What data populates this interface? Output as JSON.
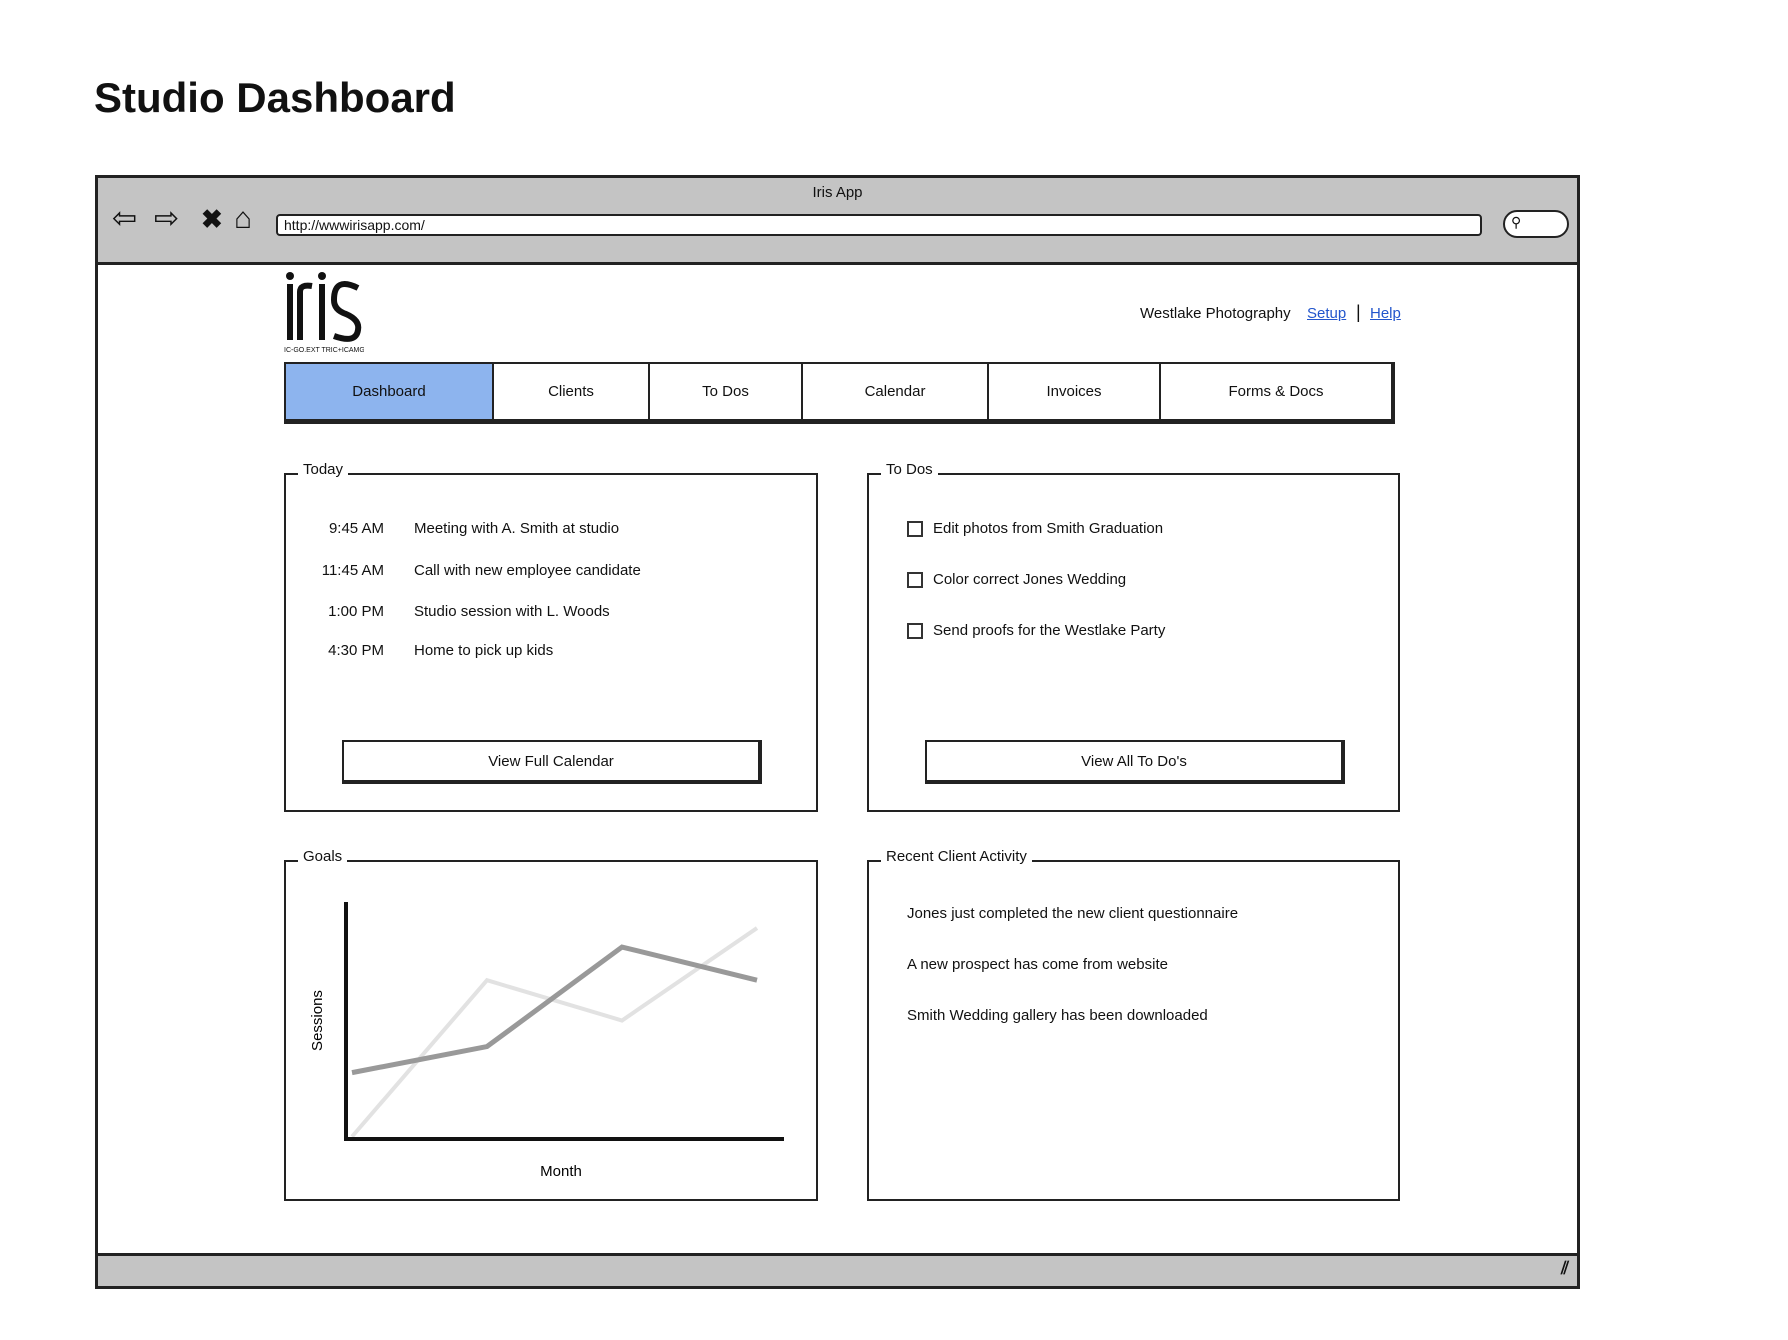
{
  "page_title": "Studio Dashboard",
  "browser": {
    "title": "Iris App",
    "url": "http://wwwirisapp.com/",
    "icons": [
      "back-arrow-icon",
      "forward-arrow-icon",
      "close-x-icon",
      "home-icon",
      "search-icon"
    ]
  },
  "app": {
    "logo_text": "iris",
    "logo_tagline": "IC-GO.EXT TRIC+ICAMG",
    "account_name": "Westlake Photography",
    "setup_link": "Setup",
    "separator": "|",
    "help_link": "Help"
  },
  "tabs": [
    {
      "label": "Dashboard",
      "active": true
    },
    {
      "label": "Clients"
    },
    {
      "label": "To Dos"
    },
    {
      "label": "Calendar"
    },
    {
      "label": "Invoices"
    },
    {
      "label": "Forms & Docs"
    }
  ],
  "accent_color": "#8db4ee",
  "today": {
    "title": "Today",
    "events": [
      {
        "time": "9:45 AM",
        "text": "Meeting with A. Smith at studio"
      },
      {
        "time": "11:45 AM",
        "text": "Call with new employee candidate"
      },
      {
        "time": "1:00 PM",
        "text": "Studio session with L. Woods"
      },
      {
        "time": "4:30 PM",
        "text": "Home to pick up kids"
      }
    ],
    "button": "View Full Calendar"
  },
  "todos": {
    "title": "To Dos",
    "items": [
      {
        "text": "Edit photos from Smith Graduation",
        "checked": false
      },
      {
        "text": "Color correct Jones Wedding",
        "checked": false
      },
      {
        "text": "Send proofs for the Westlake Party",
        "checked": false
      }
    ],
    "button": "View All To Do's"
  },
  "goals": {
    "title": "Goals"
  },
  "activity": {
    "title": "Recent Client Activity",
    "items": [
      "Jones just completed the new client questionnaire",
      "A new prospect has come from website",
      "Smith Wedding gallery has been downloaded"
    ]
  },
  "chart_data": {
    "type": "line",
    "xlabel": "Month",
    "ylabel": "Sessions",
    "x": [
      1,
      2,
      3,
      4
    ],
    "ylim": [
      0,
      100
    ],
    "grid": false,
    "series": [
      {
        "color": "#999999",
        "values": [
          28,
          39,
          81,
          67
        ]
      },
      {
        "color": "#e2e2e2",
        "values": [
          1,
          67,
          50,
          89
        ]
      }
    ]
  }
}
